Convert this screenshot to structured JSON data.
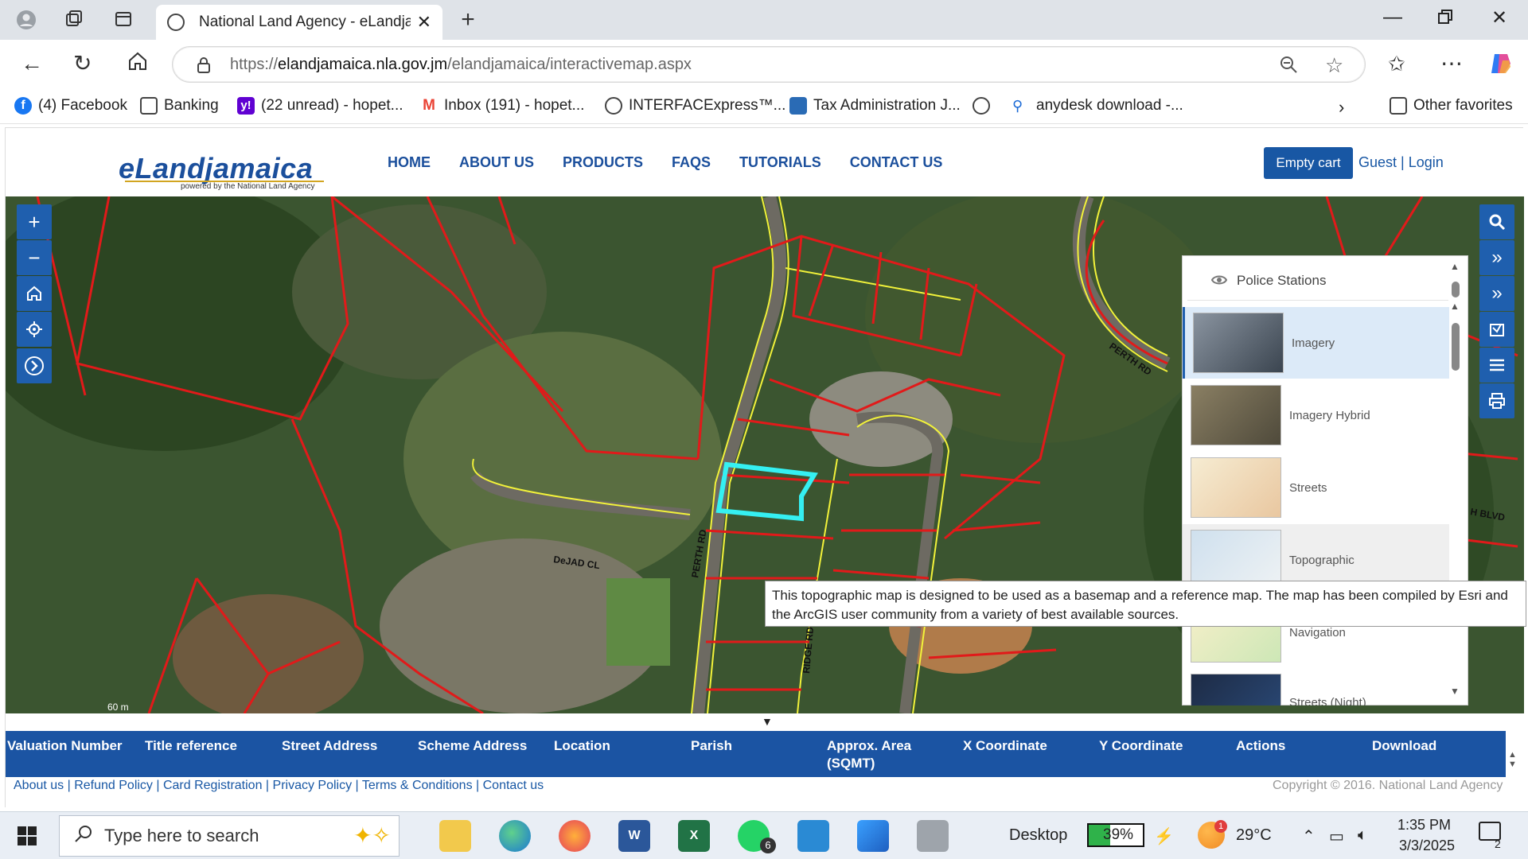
{
  "browser": {
    "tab_title": "National Land Agency - eLandjam",
    "url_prefix": "https://",
    "url_domain": "elandjamaica.nla.gov.jm",
    "url_path": "/elandjamaica/interactivemap.aspx"
  },
  "bookmarks": [
    {
      "label": "(4) Facebook",
      "icon": "facebook-icon",
      "color": "#1877f2"
    },
    {
      "label": "Banking",
      "icon": "folder-icon",
      "color": "#ffffff"
    },
    {
      "label": "(22 unread) - hopet...",
      "icon": "yahoo-icon",
      "color": "#6001d2"
    },
    {
      "label": "Inbox (191) - hopet...",
      "icon": "gmail-icon",
      "color": "#ea4335"
    },
    {
      "label": "INTERFACExpress™...",
      "icon": "globe-icon",
      "color": "#ffffff"
    },
    {
      "label": "Tax Administration J...",
      "icon": "tax-icon",
      "color": "#2a6bb5"
    },
    {
      "label": "",
      "icon": "globe-icon",
      "color": "#ffffff"
    },
    {
      "label": "anydesk download -...",
      "icon": "search-icon",
      "color": "#ffffff"
    }
  ],
  "other_favorites": "Other favorites",
  "site": {
    "logo": "eLandjamaica",
    "logo_sub": "powered by the National Land Agency",
    "menu": [
      "HOME",
      "ABOUT US",
      "PRODUCTS",
      "FAQS",
      "TUTORIALS",
      "CONTACT US"
    ],
    "cart": "Empty cart",
    "login": "Guest | Login"
  },
  "map": {
    "road_labels": [
      "DeJAD CL",
      "PERTH RD",
      "RIDGE RD",
      "PERTH RD",
      "H BLVD"
    ],
    "scale": "60 m",
    "layers_header": "Police Stations",
    "basemaps": [
      {
        "label": "Imagery",
        "color": "#5c6470",
        "selected": true
      },
      {
        "label": "Imagery Hybrid",
        "color": "#6e6a55",
        "selected": false
      },
      {
        "label": "Streets",
        "color": "#f1e5c6",
        "selected": false
      },
      {
        "label": "Topographic",
        "color": "#d8e4ee",
        "selected": false
      },
      {
        "label": "Navigation",
        "color": "#f3ecc9",
        "selected": false
      },
      {
        "label": "Streets (Night)",
        "color": "#1d2b45",
        "selected": false
      }
    ],
    "tooltip": "This topographic map is designed to be used as a basemap and a reference map.  The map has been compiled by Esri and the ArcGIS user community from a variety of best available sources."
  },
  "table": {
    "headers": [
      "Valuation Number",
      "Title reference",
      "Street Address",
      "Scheme Address",
      "Location",
      "Parish",
      "Approx. Area (SQMT)",
      "X Coordinate",
      "Y Coordinate",
      "Actions",
      "Download"
    ],
    "footer_links": "About us | Refund Policy | Card Registration | Privacy Policy | Terms & Conditions | Contact us",
    "copyright": "Copyright © 2016. National Land Agency"
  },
  "taskbar": {
    "search_placeholder": "Type here to search",
    "desktop": "Desktop",
    "battery": "39%",
    "weather": "29°C",
    "time": "1:35 PM",
    "date": "3/3/2025",
    "notifications": "2",
    "whatsapp_badge": "6",
    "weather_badge": "1"
  }
}
